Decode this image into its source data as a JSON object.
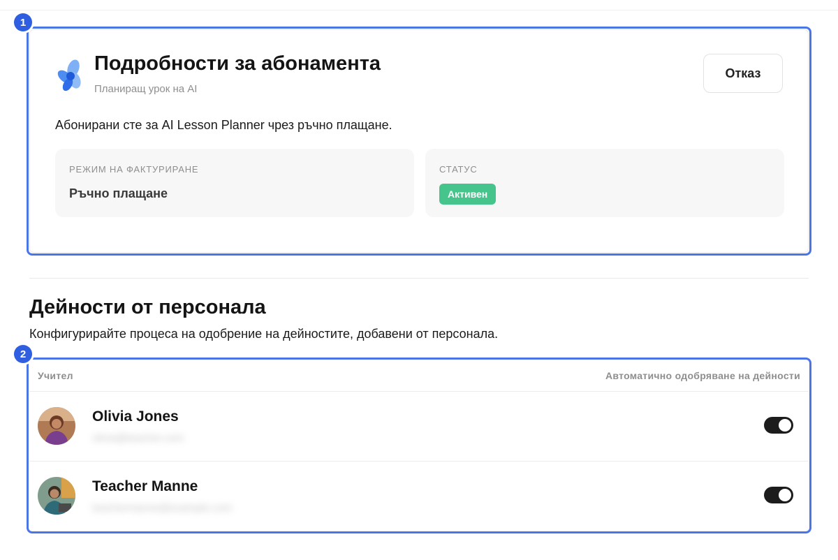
{
  "subscription": {
    "title": "Подробности за абонамента",
    "subtitle": "Планиращ урок на AI",
    "cancel_label": "Отказ",
    "description": "Абонирани сте за AI Lesson Planner чрез ръчно плащане.",
    "billing_label": "РЕЖИМ НА ФАКТУРИРАНЕ",
    "billing_value": "Ръчно плащане",
    "status_label": "СТАТУС",
    "status_value": "Активен"
  },
  "staff": {
    "title": "Дейности от персонала",
    "description": "Конфигурирайте процеса на одобрение на дейностите, добавени от персонала.",
    "col_teacher": "Учител",
    "col_auto": "Автоматично одобряване на дейности",
    "rows": [
      {
        "name": "Olivia Jones",
        "email": "olivia@teacher.com",
        "auto_approve": true
      },
      {
        "name": "Teacher Manne",
        "email": "teachermanne@example.com",
        "auto_approve": true
      }
    ]
  },
  "callouts": [
    "1",
    "2"
  ],
  "colors": {
    "accent": "#4b74e6",
    "callout": "#2f5fe0",
    "status_green": "#45c48b",
    "toggle_on": "#1c1c1c"
  }
}
